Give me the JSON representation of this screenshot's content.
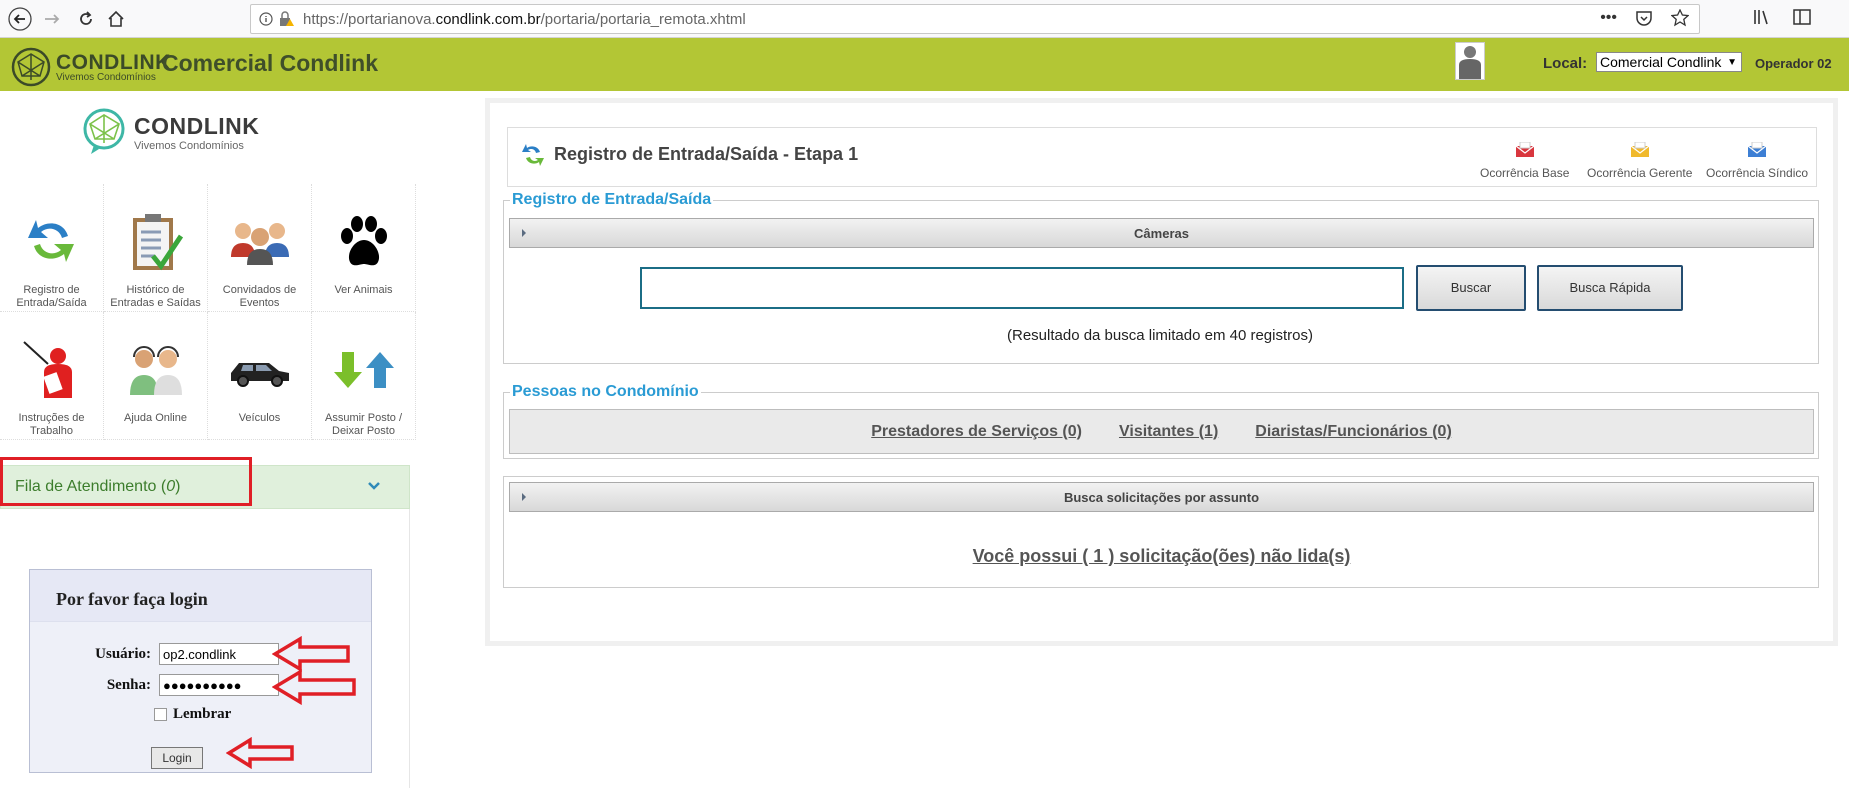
{
  "browser": {
    "url_prefix": "https://portarianova.",
    "url_domain": "condlink.com.br",
    "url_path": "/portaria/portaria_remota.xhtml"
  },
  "header": {
    "logo_title": "CONDLINK",
    "logo_subtitle": "Vivemos Condomínios",
    "company": "Comercial Condlink",
    "local_label": "Local:",
    "local_value": "Comercial Condlink",
    "operator": "Operador 02"
  },
  "sidebar": {
    "logo_title": "CONDLINK",
    "logo_subtitle": "Vivemos Condomínios",
    "menu": [
      {
        "label": "Registro de Entrada/Saída",
        "icon": "exchange-arrows-icon"
      },
      {
        "label": "Histórico de Entradas e Saídas",
        "icon": "clipboard-check-icon"
      },
      {
        "label": "Convidados de Eventos",
        "icon": "people-group-icon"
      },
      {
        "label": "Ver Animais",
        "icon": "paw-icon"
      },
      {
        "label": "Instruções de Trabalho",
        "icon": "presenter-icon"
      },
      {
        "label": "Ajuda Online",
        "icon": "support-agents-icon"
      },
      {
        "label": "Veículos",
        "icon": "car-icon"
      },
      {
        "label": "Assumir Posto / Deixar Posto",
        "icon": "up-down-arrows-icon"
      }
    ],
    "queue_label": "Fila de Atendimento (",
    "queue_count": "0",
    "queue_close": ")"
  },
  "login": {
    "title": "Por favor faça login",
    "user_label": "Usuário:",
    "user_value": "op2.condlink",
    "pass_label": "Senha:",
    "pass_value": "●●●●●●●●●●",
    "remember_label": "Lembrar",
    "button": "Login"
  },
  "main": {
    "title": "Registro de Entrada/Saída - Etapa 1",
    "occurrences": [
      {
        "label": "Ocorrência Base",
        "color": "#d9363e"
      },
      {
        "label": "Ocorrência Gerente",
        "color": "#f0b92c"
      },
      {
        "label": "Ocorrência Síndico",
        "color": "#3d7fd4"
      }
    ],
    "registro_legend": "Registro de Entrada/Saída",
    "cameras": "Câmeras",
    "search_button": "Buscar",
    "quick_search_button": "Busca Rápida",
    "search_note": "(Resultado da busca limitado em 40 registros)",
    "people_legend": "Pessoas no Condomínio",
    "people_links": [
      "Prestadores de Serviços (0)",
      "Visitantes (1)",
      "Diaristas/Funcionários (0)"
    ],
    "requests_bar": "Busca solicitações por assunto",
    "unread": "Você possui ( 1 ) solicitação(ões) não lida(s)"
  },
  "colors": {
    "header_green": "#b3c635",
    "accent_blue": "#2a9bd4",
    "annotation_red": "#e01f26"
  }
}
